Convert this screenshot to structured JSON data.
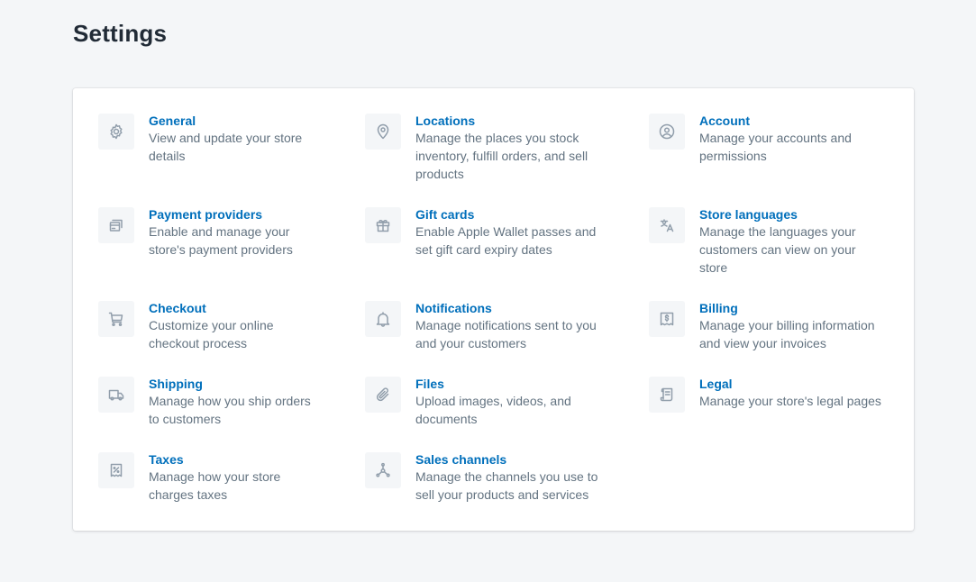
{
  "page": {
    "title": "Settings"
  },
  "items": [
    {
      "title": "General",
      "desc": "View and update your store details",
      "icon": "gear-icon"
    },
    {
      "title": "Locations",
      "desc": "Manage the places you stock inventory, fulfill orders, and sell products",
      "icon": "location-pin-icon"
    },
    {
      "title": "Account",
      "desc": "Manage your accounts and permissions",
      "icon": "user-circle-icon"
    },
    {
      "title": "Payment providers",
      "desc": "Enable and manage your store's payment providers",
      "icon": "payment-icon"
    },
    {
      "title": "Gift cards",
      "desc": "Enable Apple Wallet passes and set gift card expiry dates",
      "icon": "gift-icon"
    },
    {
      "title": "Store languages",
      "desc": "Manage the languages your customers can view on your store",
      "icon": "translate-icon"
    },
    {
      "title": "Checkout",
      "desc": "Customize your online checkout process",
      "icon": "cart-icon"
    },
    {
      "title": "Notifications",
      "desc": "Manage notifications sent to you and your customers",
      "icon": "bell-icon"
    },
    {
      "title": "Billing",
      "desc": "Manage your billing information and view your invoices",
      "icon": "receipt-dollar-icon"
    },
    {
      "title": "Shipping",
      "desc": "Manage how you ship orders to customers",
      "icon": "truck-icon"
    },
    {
      "title": "Files",
      "desc": "Upload images, videos, and documents",
      "icon": "paperclip-icon"
    },
    {
      "title": "Legal",
      "desc": "Manage your store's legal pages",
      "icon": "document-icon"
    },
    {
      "title": "Taxes",
      "desc": "Manage how your store charges taxes",
      "icon": "tax-receipt-icon"
    },
    {
      "title": "Sales channels",
      "desc": "Manage the channels you use to sell your products and services",
      "icon": "channels-icon"
    }
  ],
  "colors": {
    "link": "#006fbb",
    "muted": "#637381",
    "background": "#f4f6f8",
    "icon": "#919eab"
  }
}
